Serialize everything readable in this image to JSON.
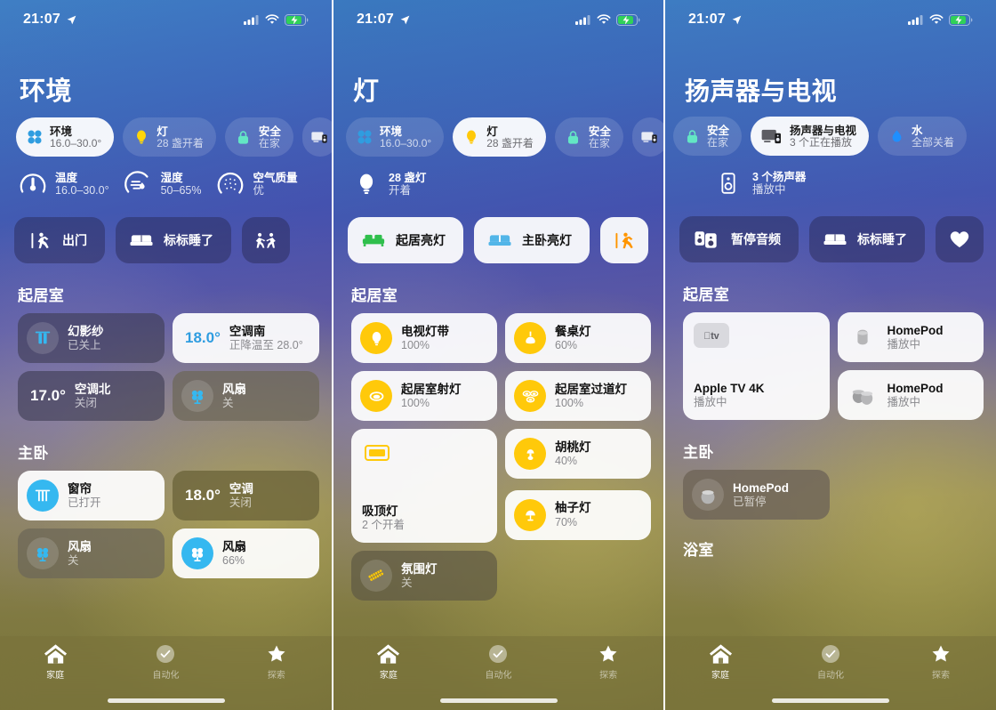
{
  "status_bar": {
    "time": "21:07",
    "location_icon": "location-arrow-icon",
    "cellular_icon": "cellular-bars-icon",
    "wifi_icon": "wifi-icon",
    "battery_icon": "battery-charging-icon"
  },
  "tabs": [
    {
      "label": "家庭",
      "icon": "home-icon",
      "active": true
    },
    {
      "label": "自动化",
      "icon": "automation-clock-icon",
      "active": false
    },
    {
      "label": "探索",
      "icon": "star-icon",
      "active": false
    }
  ],
  "panels": [
    {
      "id": "climate",
      "title": "环境",
      "chips": [
        {
          "title": "环境",
          "subtitle": "16.0–30.0°",
          "icon": "fan-climate-icon",
          "active": true
        },
        {
          "title": "灯",
          "subtitle": "28 盏开着",
          "icon": "bulb-icon",
          "active": false
        },
        {
          "title": "安全",
          "subtitle": "在家",
          "icon": "lock-icon",
          "active": false
        },
        {
          "title": "",
          "subtitle": "",
          "icon": "tv-speaker-icon",
          "active": false
        }
      ],
      "summary": [
        {
          "title": "温度",
          "value": "16.0–30.0°",
          "icon": "thermometer-gauge-icon"
        },
        {
          "title": "湿度",
          "value": "50–65%",
          "icon": "humidity-gauge-icon"
        },
        {
          "title": "空气质量",
          "value": "优",
          "icon": "air-quality-gauge-icon"
        }
      ],
      "scenes": [
        {
          "label": "出门",
          "icon": "walk-out-icon",
          "style": "dark"
        },
        {
          "label": "标标睡了",
          "icon": "bed-icon",
          "style": "dark"
        },
        {
          "label": "",
          "icon": "people-icon",
          "style": "dark"
        }
      ],
      "sections": [
        {
          "name": "起居室",
          "tiles": [
            {
              "name": "幻影纱",
              "state": "已关上",
              "icon": "curtain-icon",
              "style": "dark",
              "temp": ""
            },
            {
              "name": "空调南",
              "state": "正降温至 28.0°",
              "icon": "",
              "style": "light",
              "temp": "18.0°"
            },
            {
              "name": "空调北",
              "state": "关闭",
              "icon": "",
              "style": "dark",
              "temp": "17.0°"
            },
            {
              "name": "风扇",
              "state": "关",
              "icon": "fan-icon",
              "style": "greydark",
              "temp": ""
            }
          ]
        },
        {
          "name": "主卧",
          "tiles": [
            {
              "name": "窗帘",
              "state": "已打开",
              "icon": "blinds-icon",
              "style": "light",
              "temp": ""
            },
            {
              "name": "空调",
              "state": "关闭",
              "icon": "",
              "style": "olive",
              "temp": "18.0°"
            },
            {
              "name": "风扇",
              "state": "关",
              "icon": "fan-icon",
              "style": "greydark",
              "temp": ""
            },
            {
              "name": "风扇",
              "state": "66%",
              "icon": "fan-icon-blue",
              "style": "light",
              "temp": ""
            }
          ]
        }
      ]
    },
    {
      "id": "lights",
      "title": "灯",
      "chips": [
        {
          "title": "环境",
          "subtitle": "16.0–30.0°",
          "icon": "fan-climate-icon",
          "active": false
        },
        {
          "title": "灯",
          "subtitle": "28 盏开着",
          "icon": "bulb-icon",
          "active": true
        },
        {
          "title": "安全",
          "subtitle": "在家",
          "icon": "lock-icon",
          "active": false
        },
        {
          "title": "",
          "subtitle": "",
          "icon": "tv-speaker-icon",
          "active": false
        }
      ],
      "summary": [
        {
          "title": "28 盏灯",
          "value": "开着",
          "icon": "bulb-white-icon"
        }
      ],
      "scenes": [
        {
          "label": "起居亮灯",
          "icon": "sofa-green-icon",
          "style": "light"
        },
        {
          "label": "主卧亮灯",
          "icon": "bed-blue-icon",
          "style": "light"
        },
        {
          "label": "",
          "icon": "walk-orange-icon",
          "style": "light"
        }
      ],
      "sections": [
        {
          "name": "起居室",
          "tiles": [
            {
              "name": "电视灯带",
              "state": "100%",
              "icon": "bulb-yellow-icon",
              "style": "light",
              "temp": ""
            },
            {
              "name": "餐桌灯",
              "state": "60%",
              "icon": "pendant-lamp-icon",
              "style": "light",
              "temp": ""
            },
            {
              "name": "起居室射灯",
              "state": "100%",
              "icon": "spotlight-icon",
              "style": "light",
              "temp": ""
            },
            {
              "name": "起居室过道灯",
              "state": "100%",
              "icon": "double-spotlight-icon",
              "style": "light",
              "temp": ""
            },
            {
              "name": "吸顶灯",
              "state": "2 个开着",
              "icon": "ceiling-light-icon",
              "style": "light-tall",
              "temp": ""
            },
            {
              "name": "胡桃灯",
              "state": "40%",
              "icon": "table-lamp-icon",
              "style": "light",
              "temp": ""
            },
            {
              "name": "柚子灯",
              "state": "70%",
              "icon": "table-lamp2-icon",
              "style": "light",
              "temp": ""
            },
            {
              "name": "氛围灯",
              "state": "关",
              "icon": "strip-light-icon",
              "style": "warmdark",
              "temp": ""
            }
          ]
        }
      ]
    },
    {
      "id": "speakers",
      "title": "扬声器与电视",
      "chips": [
        {
          "title": "",
          "subtitle": "",
          "icon": "bulb-icon",
          "active": false
        },
        {
          "title": "安全",
          "subtitle": "在家",
          "icon": "lock-icon",
          "active": false
        },
        {
          "title": "扬声器与电视",
          "subtitle": "3 个正在播放",
          "icon": "tv-speaker-icon",
          "active": true
        },
        {
          "title": "水",
          "subtitle": "全部关着",
          "icon": "water-drop-icon",
          "active": false
        }
      ],
      "summary": [
        {
          "title": "3 个扬声器",
          "value": "播放中",
          "icon": "speaker-white-icon"
        }
      ],
      "scenes": [
        {
          "label": "暂停音频",
          "icon": "pause-audio-icon",
          "style": "dark"
        },
        {
          "label": "标标睡了",
          "icon": "bed-icon",
          "style": "dark"
        },
        {
          "label": "",
          "icon": "heart-icon",
          "style": "dark"
        }
      ],
      "sections": [
        {
          "name": "起居室",
          "tiles": [
            {
              "name": "Apple TV 4K",
              "state": "播放中",
              "icon": "apple-tv-icon",
              "style": "light-tall",
              "temp": ""
            },
            {
              "name": "HomePod",
              "state": "播放中",
              "icon": "homepod-icon",
              "style": "light",
              "temp": ""
            },
            {
              "name": "HomePod",
              "state": "播放中",
              "icon": "homepod-pair-icon",
              "style": "light",
              "temp": ""
            }
          ]
        },
        {
          "name": "主卧",
          "tiles": [
            {
              "name": "HomePod",
              "state": "已暂停",
              "icon": "homepod-mini-icon",
              "style": "brown",
              "temp": ""
            }
          ]
        },
        {
          "name": "浴室",
          "tiles": []
        }
      ]
    }
  ],
  "colors": {
    "accent_blue": "#2f9de0",
    "yellow": "#f5b61a",
    "green": "#34c759",
    "mint": "#63e6c4",
    "orange": "#ff9500"
  }
}
